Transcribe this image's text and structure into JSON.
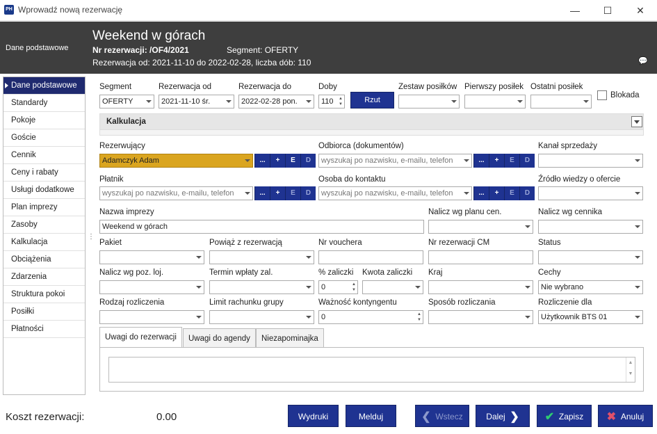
{
  "window": {
    "title": "Wprowadź nową rezerwację",
    "logo": "PH"
  },
  "header": {
    "left_label": "Dane podstawowe",
    "title": "Weekend w górach",
    "nr_label": "Nr rezerwacji: /OF4/2021",
    "segment": "Segment: OFERTY",
    "dates": "Rezerwacja od: 2021-11-10 do 2022-02-28, liczba dób: 110"
  },
  "sidebar": {
    "items": [
      "Dane podstawowe",
      "Standardy",
      "Pokoje",
      "Goście",
      "Cennik",
      "Ceny i rabaty",
      "Usługi dodatkowe",
      "Plan imprezy",
      "Zasoby",
      "Kalkulacja",
      "Obciążenia",
      "Zdarzenia",
      "Struktura pokoi",
      "Posiłki",
      "Płatności"
    ]
  },
  "form": {
    "segment": {
      "label": "Segment",
      "value": "OFERTY"
    },
    "rez_od": {
      "label": "Rezerwacja od",
      "value": "2021-11-10 śr."
    },
    "rez_do": {
      "label": "Rezerwacja do",
      "value": "2022-02-28 pon."
    },
    "doby": {
      "label": "Doby",
      "value": "110"
    },
    "rzut": "Rzut",
    "zestaw": {
      "label": "Zestaw posiłków"
    },
    "pierwszy": {
      "label": "Pierwszy posiłek"
    },
    "ostatni": {
      "label": "Ostatni posiłek"
    },
    "blokada": "Blokada",
    "kalkulacja": "Kalkulacja",
    "rezerwujacy": {
      "label": "Rezerwujący",
      "value": "Adamczyk Adam"
    },
    "odbiorca": {
      "label": "Odbiorca (dokumentów)",
      "placeholder": "wyszukaj po nazwisku, e-mailu, telefon"
    },
    "kanal": {
      "label": "Kanał sprzedaży"
    },
    "platnik": {
      "label": "Płatnik",
      "placeholder": "wyszukaj po nazwisku, e-mailu, telefon"
    },
    "osoba": {
      "label": "Osoba do kontaktu",
      "placeholder": "wyszukaj po nazwisku, e-mailu, telefon"
    },
    "zrodlo": {
      "label": "Źródło wiedzy o ofercie"
    },
    "nazwa": {
      "label": "Nazwa imprezy",
      "value": "Weekend w górach"
    },
    "nalicz_plan": {
      "label": "Nalicz wg planu cen."
    },
    "nalicz_cennik": {
      "label": "Nalicz wg cennika"
    },
    "pakiet": {
      "label": "Pakiet"
    },
    "powiaz": {
      "label": "Powiąż z rezerwacją"
    },
    "voucher": {
      "label": "Nr vouchera"
    },
    "nr_cm": {
      "label": "Nr rezerwacji CM"
    },
    "status": {
      "label": "Status"
    },
    "nalicz_poz": {
      "label": "Nalicz wg poz. loj."
    },
    "termin": {
      "label": "Termin wpłaty zal."
    },
    "proc_zal": {
      "label": "% zaliczki",
      "value": "0"
    },
    "kwota_zal": {
      "label": "Kwota zaliczki"
    },
    "kraj": {
      "label": "Kraj"
    },
    "cechy": {
      "label": "Cechy",
      "value": "Nie wybrano"
    },
    "rodzaj": {
      "label": "Rodzaj rozliczenia"
    },
    "limit": {
      "label": "Limit rachunku grupy"
    },
    "waznosc": {
      "label": "Ważność kontyngentu",
      "value": "0"
    },
    "sposob": {
      "label": "Sposób rozliczania"
    },
    "rozl_dla": {
      "label": "Rozliczenie dla",
      "value": "Użytkownik BTS 01"
    },
    "btn_dots": "...",
    "btn_plus": "+",
    "btn_e": "E",
    "btn_d": "D"
  },
  "tabs": [
    "Uwagi do rezerwacji",
    "Uwagi do agendy",
    "Niezapominajka"
  ],
  "footer": {
    "koszt_label": "Koszt rezerwacji:",
    "koszt_value": "0.00",
    "wydruki": "Wydruki",
    "melduj": "Melduj",
    "wstecz": "Wstecz",
    "dalej": "Dalej",
    "zapisz": "Zapisz",
    "anuluj": "Anuluj"
  }
}
